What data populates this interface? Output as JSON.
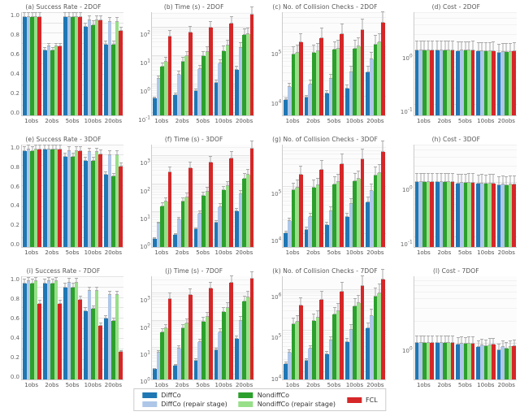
{
  "chart_data": [
    {
      "id": "a",
      "title": "(a) Success Rate - 2DOF",
      "scale": "linear",
      "yticks": [
        "1.0",
        "0.8",
        "0.6",
        "0.4",
        "0.2",
        "0.0"
      ],
      "ylim": [
        0,
        1.05
      ],
      "categories": [
        "1obs",
        "2obs",
        "5obs",
        "10obs",
        "20obs"
      ],
      "series": [
        {
          "name": "DiffCo",
          "v": [
            1.0,
            0.66,
            1.0,
            0.9,
            0.72
          ]
        },
        {
          "name": "DiffCo (repair stage)",
          "v": [
            1.0,
            0.7,
            1.0,
            0.97,
            0.95
          ]
        },
        {
          "name": "NondiffCo",
          "v": [
            1.0,
            0.66,
            1.0,
            0.92,
            0.72
          ]
        },
        {
          "name": "NondiffCo (repair stage)",
          "v": [
            1.0,
            0.7,
            1.0,
            0.97,
            0.95
          ]
        },
        {
          "name": "FCL",
          "v": [
            1.0,
            0.7,
            1.0,
            0.97,
            0.86
          ]
        }
      ]
    },
    {
      "id": "b",
      "title": "(b) Time (s) - 2DOF",
      "scale": "log",
      "log_exps_vis": [
        -1,
        0,
        1,
        2
      ],
      "ylim_exp": [
        -1.1,
        2.5
      ],
      "categories": [
        "1obs",
        "2obs",
        "5obs",
        "10obs",
        "20obs"
      ],
      "series": [
        {
          "name": "DiffCo",
          "v": [
            0.3,
            0.4,
            0.55,
            1.1,
            3.0
          ]
        },
        {
          "name": "DiffCo (repair stage)",
          "v": [
            1.5,
            2.1,
            3.3,
            5.0,
            18
          ]
        },
        {
          "name": "NondiffCo",
          "v": [
            4,
            6,
            9,
            14,
            50
          ]
        },
        {
          "name": "NondiffCo (repair stage)",
          "v": [
            6,
            9,
            13,
            22,
            55
          ]
        },
        {
          "name": "FCL",
          "v": [
            45,
            60,
            90,
            130,
            260
          ]
        }
      ]
    },
    {
      "id": "c",
      "title": "(c) No. of Collision Checks - 2DOF",
      "scale": "log",
      "log_exps_vis": [
        4,
        5
      ],
      "ylim_exp": [
        3.6,
        5.7
      ],
      "categories": [
        "1obs",
        "2obs",
        "5obs",
        "10obs",
        "20obs"
      ],
      "series": [
        {
          "name": "DiffCo",
          "v": [
            8000,
            9000,
            11000,
            14000,
            30000
          ]
        },
        {
          "name": "DiffCo (repair stage)",
          "v": [
            15000,
            17000,
            22000,
            30000,
            55000
          ]
        },
        {
          "name": "NondiffCo",
          "v": [
            70000,
            75000,
            85000,
            90000,
            110000
          ]
        },
        {
          "name": "NondiffCo (repair stage)",
          "v": [
            75000,
            80000,
            90000,
            100000,
            120000
          ]
        },
        {
          "name": "FCL",
          "v": [
            120000,
            150000,
            180000,
            220000,
            300000
          ]
        }
      ]
    },
    {
      "id": "d",
      "title": "(d) Cost - 2DOF",
      "scale": "log",
      "log_exps_vis": [
        -1,
        0
      ],
      "ylim_exp": [
        -1.2,
        0.7
      ],
      "categories": [
        "1obs",
        "2obs",
        "5obs",
        "10obs",
        "20obs"
      ],
      "series": [
        {
          "name": "DiffCo",
          "v": [
            1.0,
            1.0,
            0.97,
            0.95,
            0.9
          ]
        },
        {
          "name": "DiffCo (repair stage)",
          "v": [
            1.0,
            1.0,
            0.98,
            0.96,
            0.92
          ]
        },
        {
          "name": "NondiffCo",
          "v": [
            1.0,
            1.0,
            0.98,
            0.96,
            0.92
          ]
        },
        {
          "name": "NondiffCo (repair stage)",
          "v": [
            1.0,
            1.0,
            0.98,
            0.96,
            0.93
          ]
        },
        {
          "name": "FCL",
          "v": [
            1.0,
            1.0,
            0.99,
            0.97,
            0.94
          ]
        }
      ]
    },
    {
      "id": "e",
      "title": "(e) Success Rate - 3DOF",
      "scale": "linear",
      "yticks": [
        "1.0",
        "0.8",
        "0.6",
        "0.4",
        "0.2",
        "0.0"
      ],
      "ylim": [
        0,
        1.05
      ],
      "categories": [
        "1obs",
        "2obs",
        "5obs",
        "10obs",
        "20obs"
      ],
      "series": [
        {
          "name": "DiffCo",
          "v": [
            0.98,
            1.0,
            0.92,
            0.88,
            0.74
          ]
        },
        {
          "name": "DiffCo (repair stage)",
          "v": [
            1.0,
            1.0,
            0.98,
            0.97,
            0.94
          ]
        },
        {
          "name": "NondiffCo",
          "v": [
            0.98,
            1.0,
            0.92,
            0.88,
            0.72
          ]
        },
        {
          "name": "NondiffCo (repair stage)",
          "v": [
            1.0,
            1.0,
            0.98,
            0.97,
            0.94
          ]
        },
        {
          "name": "FCL",
          "v": [
            1.0,
            1.0,
            0.98,
            0.95,
            0.82
          ]
        }
      ]
    },
    {
      "id": "f",
      "title": "(f) Time (s) - 3DOF",
      "scale": "log",
      "log_exps_vis": [
        0,
        1,
        2,
        3
      ],
      "ylim_exp": [
        -0.3,
        3.4
      ],
      "categories": [
        "1obs",
        "2obs",
        "5obs",
        "10obs",
        "20obs"
      ],
      "series": [
        {
          "name": "DiffCo",
          "v": [
            1.0,
            1.4,
            2.2,
            3.8,
            10
          ]
        },
        {
          "name": "DiffCo (repair stage)",
          "v": [
            3.5,
            5,
            8,
            14,
            40
          ]
        },
        {
          "name": "NondiffCo",
          "v": [
            15,
            22,
            35,
            55,
            150
          ]
        },
        {
          "name": "NondiffCo (repair stage)",
          "v": [
            22,
            32,
            50,
            80,
            200
          ]
        },
        {
          "name": "FCL",
          "v": [
            250,
            350,
            550,
            800,
            1800
          ]
        }
      ]
    },
    {
      "id": "g",
      "title": "(g) No. of Collision Checks - 3DOF",
      "scale": "log",
      "log_exps_vis": [
        4,
        5
      ],
      "ylim_exp": [
        3.7,
        5.9
      ],
      "categories": [
        "1obs",
        "2obs",
        "5obs",
        "10obs",
        "20obs"
      ],
      "series": [
        {
          "name": "DiffCo",
          "v": [
            10000,
            12000,
            15000,
            22000,
            45000
          ]
        },
        {
          "name": "DiffCo (repair stage)",
          "v": [
            18000,
            22000,
            30000,
            42000,
            80000
          ]
        },
        {
          "name": "NondiffCo",
          "v": [
            85000,
            95000,
            110000,
            130000,
            170000
          ]
        },
        {
          "name": "NondiffCo (repair stage)",
          "v": [
            95000,
            105000,
            125000,
            145000,
            190000
          ]
        },
        {
          "name": "FCL",
          "v": [
            180000,
            230000,
            300000,
            380000,
            550000
          ]
        }
      ]
    },
    {
      "id": "h",
      "title": "(h) Cost - 3DOF",
      "scale": "log",
      "log_exps_vis": [
        -1,
        0
      ],
      "ylim_exp": [
        -1.2,
        0.7
      ],
      "categories": [
        "1obs",
        "2obs",
        "5obs",
        "10obs",
        "20obs"
      ],
      "series": [
        {
          "name": "DiffCo",
          "v": [
            1.0,
            1.0,
            0.96,
            0.93,
            0.87
          ]
        },
        {
          "name": "DiffCo (repair stage)",
          "v": [
            1.0,
            1.0,
            0.97,
            0.95,
            0.9
          ]
        },
        {
          "name": "NondiffCo",
          "v": [
            1.0,
            1.0,
            0.97,
            0.94,
            0.89
          ]
        },
        {
          "name": "NondiffCo (repair stage)",
          "v": [
            1.0,
            1.0,
            0.98,
            0.95,
            0.91
          ]
        },
        {
          "name": "FCL",
          "v": [
            1.0,
            1.0,
            0.98,
            0.96,
            0.92
          ]
        }
      ]
    },
    {
      "id": "i",
      "title": "(i) Success Rate - 7DOF",
      "scale": "linear",
      "yticks": [
        "1.0",
        "0.8",
        "0.6",
        "0.4",
        "0.2",
        "0.0"
      ],
      "ylim": [
        0,
        1.05
      ],
      "categories": [
        "1obs",
        "2obs",
        "5obs",
        "10obs",
        "20obs"
      ],
      "series": [
        {
          "name": "DiffCo",
          "v": [
            0.98,
            0.98,
            0.94,
            0.7,
            0.62
          ]
        },
        {
          "name": "DiffCo (repair stage)",
          "v": [
            1.0,
            1.0,
            0.99,
            0.9,
            0.86
          ]
        },
        {
          "name": "NondiffCo",
          "v": [
            0.98,
            0.98,
            0.94,
            0.72,
            0.6
          ]
        },
        {
          "name": "NondiffCo (repair stage)",
          "v": [
            1.0,
            1.0,
            0.99,
            0.9,
            0.86
          ]
        },
        {
          "name": "FCL",
          "v": [
            0.77,
            0.77,
            0.81,
            0.55,
            0.28
          ]
        }
      ]
    },
    {
      "id": "j",
      "title": "(j) Time (s) - 7DOF",
      "scale": "log",
      "log_exps_vis": [
        0,
        1,
        2,
        3
      ],
      "ylim_exp": [
        -0.2,
        3.6
      ],
      "categories": [
        "1obs",
        "2obs",
        "5obs",
        "10obs",
        "20obs"
      ],
      "series": [
        {
          "name": "DiffCo",
          "v": [
            1.5,
            2.0,
            3.2,
            7.5,
            20
          ]
        },
        {
          "name": "DiffCo (repair stage)",
          "v": [
            6,
            9,
            15,
            35,
            90
          ]
        },
        {
          "name": "NondiffCo",
          "v": [
            35,
            50,
            85,
            190,
            480
          ]
        },
        {
          "name": "NondiffCo (repair stage)",
          "v": [
            50,
            75,
            130,
            280,
            700
          ]
        },
        {
          "name": "FCL",
          "v": [
            600,
            850,
            1400,
            2300,
            3300
          ]
        }
      ]
    },
    {
      "id": "k",
      "title": "(k) No. of Collision Checks - 7DOF",
      "scale": "log",
      "log_exps_vis": [
        4,
        5,
        6
      ],
      "ylim_exp": [
        3.8,
        6.3
      ],
      "categories": [
        "1obs",
        "2obs",
        "5obs",
        "10obs",
        "20obs"
      ],
      "series": [
        {
          "name": "DiffCo",
          "v": [
            15000,
            18000,
            26000,
            50000,
            110000
          ]
        },
        {
          "name": "DiffCo (repair stage)",
          "v": [
            28000,
            35000,
            55000,
            100000,
            220000
          ]
        },
        {
          "name": "NondiffCo",
          "v": [
            140000,
            170000,
            240000,
            380000,
            650000
          ]
        },
        {
          "name": "NondiffCo (repair stage)",
          "v": [
            160000,
            200000,
            290000,
            450000,
            780000
          ]
        },
        {
          "name": "FCL",
          "v": [
            400000,
            550000,
            850000,
            1200000,
            1700000
          ]
        }
      ]
    },
    {
      "id": "l",
      "title": "(l) Cost - 7DOF",
      "scale": "log",
      "log_exps_vis": [
        0
      ],
      "ylim_exp": [
        -0.5,
        0.9
      ],
      "categories": [
        "1obs",
        "2obs",
        "5obs",
        "10obs",
        "20obs"
      ],
      "series": [
        {
          "name": "DiffCo",
          "v": [
            1.0,
            1.0,
            0.95,
            0.88,
            0.8
          ]
        },
        {
          "name": "DiffCo (repair stage)",
          "v": [
            1.0,
            1.0,
            0.97,
            0.92,
            0.87
          ]
        },
        {
          "name": "NondiffCo",
          "v": [
            1.0,
            1.0,
            0.96,
            0.9,
            0.83
          ]
        },
        {
          "name": "NondiffCo (repair stage)",
          "v": [
            1.0,
            1.0,
            0.97,
            0.93,
            0.88
          ]
        },
        {
          "name": "FCL",
          "v": [
            1.0,
            1.0,
            0.98,
            0.94,
            0.9
          ]
        }
      ]
    }
  ],
  "series_colors": {
    "DiffCo": "c-diffco",
    "DiffCo (repair stage)": "c-diffco-rep",
    "NondiffCo": "c-nondiffco",
    "NondiffCo (repair stage)": "c-nondiffco-r",
    "FCL": "c-fcl"
  },
  "legend": {
    "cols": [
      [
        {
          "label": "DiffCo",
          "color": "c-diffco"
        },
        {
          "label": "DiffCo (repair stage)",
          "color": "c-diffco-rep"
        }
      ],
      [
        {
          "label": "NondiffCo",
          "color": "c-nondiffco"
        },
        {
          "label": "NondiffCo (repair stage)",
          "color": "c-nondiffco-r"
        }
      ],
      [
        {
          "label": "FCL",
          "color": "c-fcl"
        }
      ]
    ]
  },
  "error_fraction_linear": 0.04,
  "error_fraction_log": 0.25
}
